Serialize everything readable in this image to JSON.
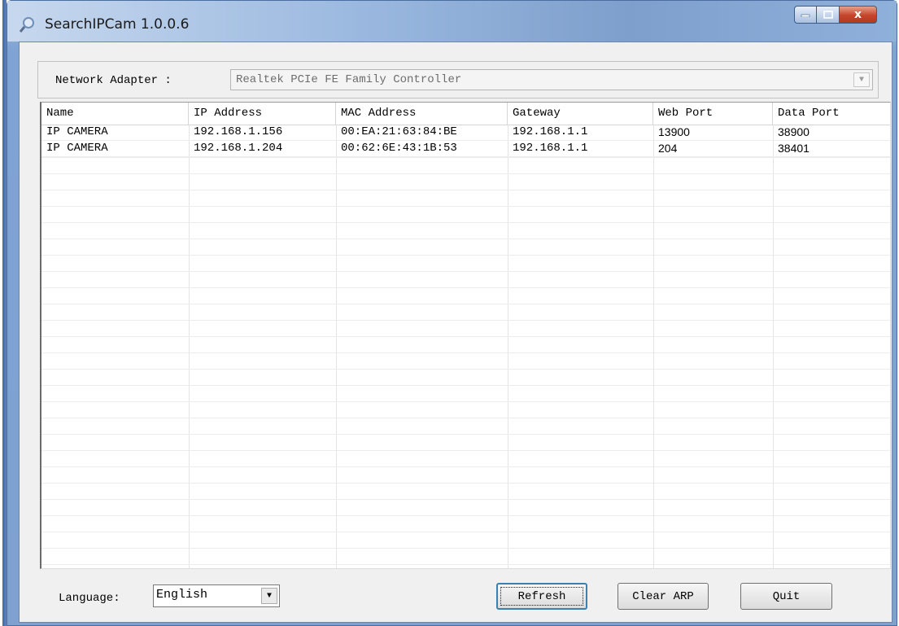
{
  "window": {
    "title": "SearchIPCam 1.0.0.6",
    "minimize_icon": "minimize-icon",
    "maximize_icon": "maximize-icon",
    "close_glyph": "x"
  },
  "adapter": {
    "label": "Network Adapter :",
    "selected": "Realtek PCIe FE Family Controller"
  },
  "table": {
    "columns": [
      "Name",
      "IP Address",
      "MAC Address",
      "Gateway",
      "Web Port",
      "Data Port"
    ],
    "rows": [
      [
        "IP CAMERA",
        "192.168.1.156",
        "00:EA:21:63:84:BE",
        "192.168.1.1",
        "13900",
        "38900"
      ],
      [
        "IP CAMERA",
        "192.168.1.204",
        "00:62:6E:43:1B:53",
        "192.168.1.1",
        "204",
        "38401"
      ]
    ]
  },
  "language": {
    "label": "Language:",
    "selected": "English"
  },
  "buttons": {
    "refresh": "Refresh",
    "clear_arp": "Clear ARP",
    "quit": "Quit"
  },
  "colors": {
    "title_bar": "#9ab8df",
    "close_button": "#c4452a",
    "default_button_border": "#3c7fb1"
  }
}
